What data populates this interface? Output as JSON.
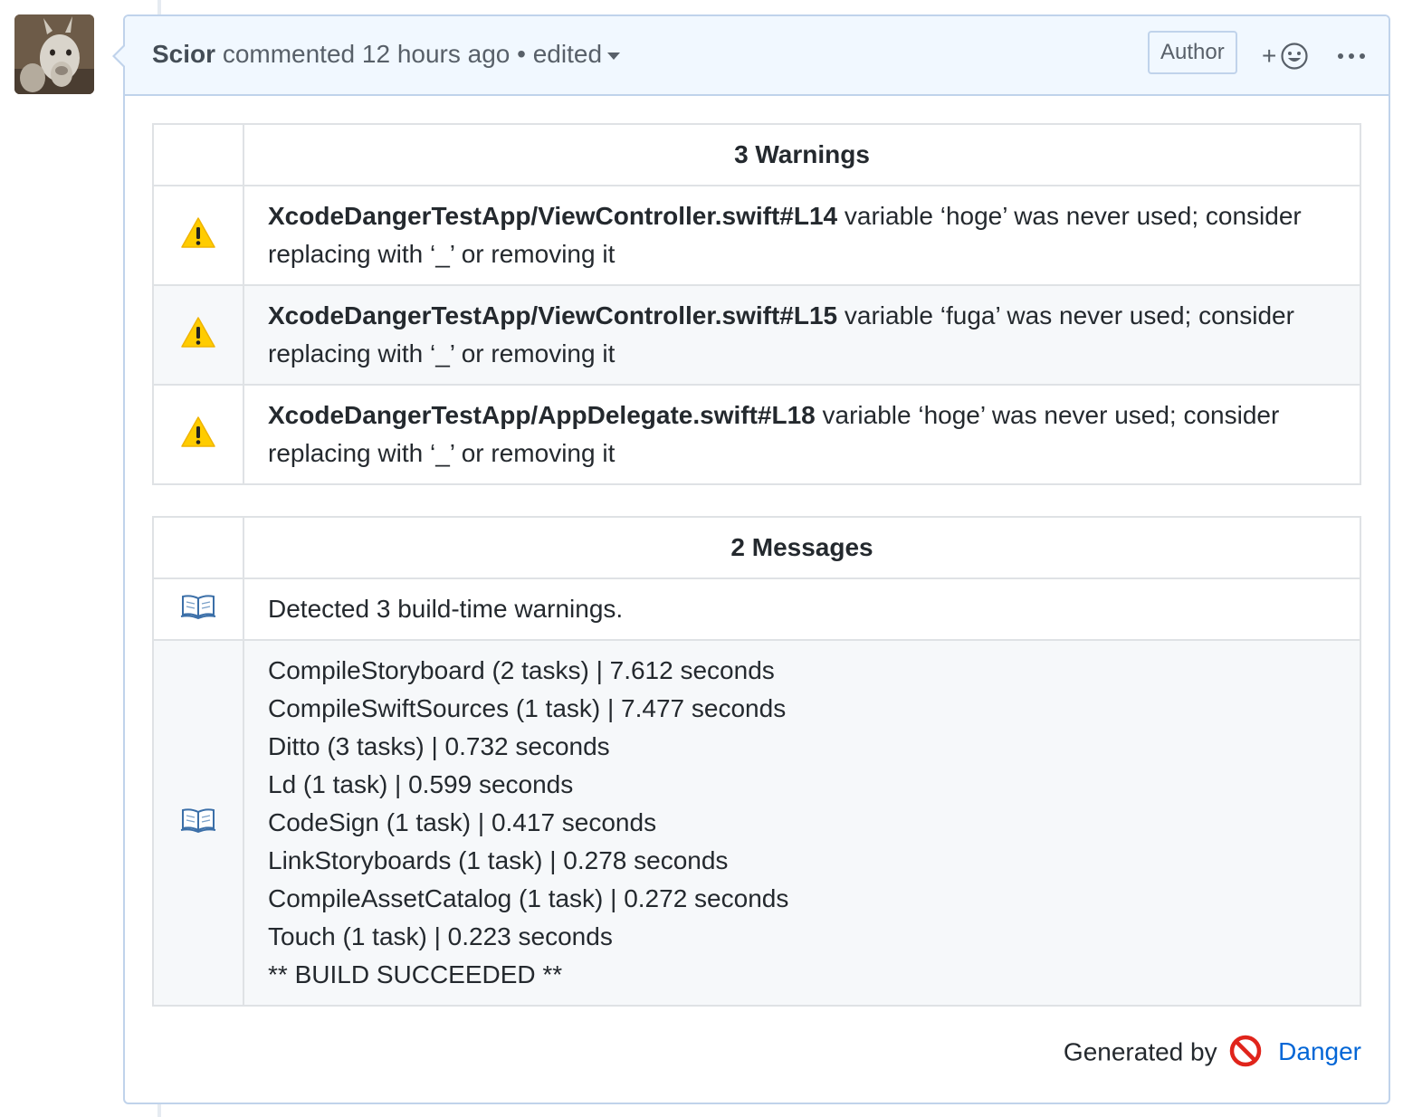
{
  "comment": {
    "author": "Scior",
    "action": "commented",
    "time": "12 hours ago",
    "separator": "•",
    "edited_label": "edited",
    "author_badge": "Author",
    "reaction_plus": "+"
  },
  "warnings": {
    "header": "3 Warnings",
    "rows": [
      {
        "file": "XcodeDangerTestApp/ViewController.swift#L14",
        "message": "variable ‘hoge’ was never used; consider replacing with ‘_’ or removing it"
      },
      {
        "file": "XcodeDangerTestApp/ViewController.swift#L15",
        "message": "variable ‘fuga’ was never used; consider replacing with ‘_’ or removing it"
      },
      {
        "file": "XcodeDangerTestApp/AppDelegate.swift#L18",
        "message": "variable ‘hoge’ was never used; consider replacing with ‘_’ or removing it"
      }
    ]
  },
  "messages": {
    "header": "2 Messages",
    "first": "Detected 3 build-time warnings.",
    "lines": [
      "CompileStoryboard (2 tasks) | 7.612 seconds",
      "CompileSwiftSources (1 task) | 7.477 seconds",
      "Ditto (3 tasks) | 0.732 seconds",
      "Ld (1 task) | 0.599 seconds",
      "CodeSign (1 task) | 0.417 seconds",
      "LinkStoryboards (1 task) | 0.278 seconds",
      "CompileAssetCatalog (1 task) | 0.272 seconds",
      "Touch (1 task) | 0.223 seconds",
      "** BUILD SUCCEEDED **"
    ]
  },
  "footer": {
    "generated_by": "Generated by",
    "link": "Danger"
  },
  "icons": {
    "warning": "warning-icon",
    "message": "open-book-icon",
    "danger": "no-entry-icon",
    "reaction": "smiley-icon",
    "more": "kebab-horizontal-icon"
  },
  "colors": {
    "header_bg": "#f1f8ff",
    "header_border": "#c0d3eb",
    "link": "#0366d6",
    "warning_yellow": "#ffcc00",
    "danger_red": "#e0241b"
  }
}
